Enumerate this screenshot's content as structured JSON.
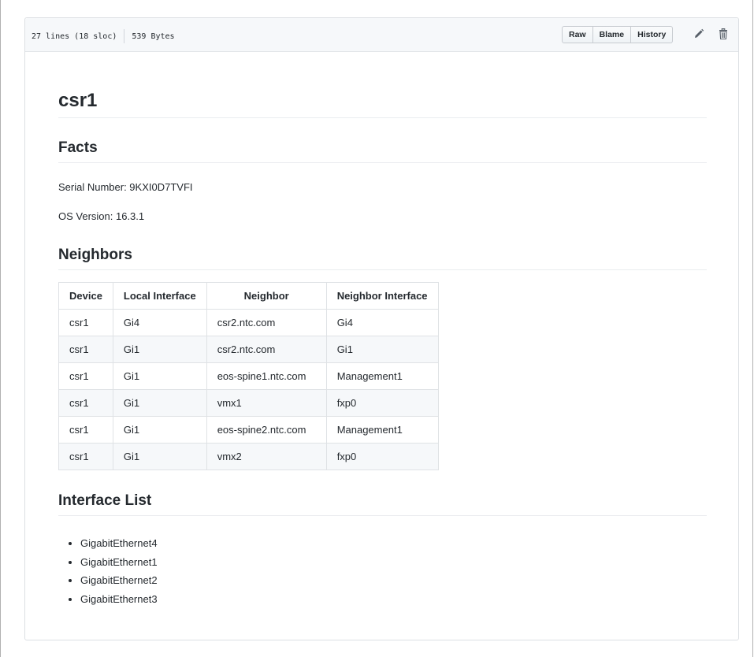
{
  "file_header": {
    "lines": "27 lines (18 sloc)",
    "size": "539 Bytes",
    "buttons": {
      "raw": "Raw",
      "blame": "Blame",
      "history": "History"
    },
    "icons": [
      "pencil-icon",
      "trash-icon"
    ]
  },
  "doc": {
    "title": "csr1",
    "facts_heading": "Facts",
    "serial_number": "Serial Number: 9KXI0D7TVFI",
    "os_version": "OS Version: 16.3.1",
    "neighbors_heading": "Neighbors",
    "table": {
      "headers": [
        "Device",
        "Local Interface",
        "Neighbor",
        "Neighbor Interface"
      ],
      "rows": [
        [
          "csr1",
          "Gi4",
          "csr2.ntc.com",
          "Gi4"
        ],
        [
          "csr1",
          "Gi1",
          "csr2.ntc.com",
          "Gi1"
        ],
        [
          "csr1",
          "Gi1",
          "eos-spine1.ntc.com",
          "Management1"
        ],
        [
          "csr1",
          "Gi1",
          "vmx1",
          "fxp0"
        ],
        [
          "csr1",
          "Gi1",
          "eos-spine2.ntc.com",
          "Management1"
        ],
        [
          "csr1",
          "Gi1",
          "vmx2",
          "fxp0"
        ]
      ]
    },
    "interface_heading": "Interface List",
    "interfaces": [
      "GigabitEthernet4",
      "GigabitEthernet1",
      "GigabitEthernet2",
      "GigabitEthernet3"
    ]
  }
}
